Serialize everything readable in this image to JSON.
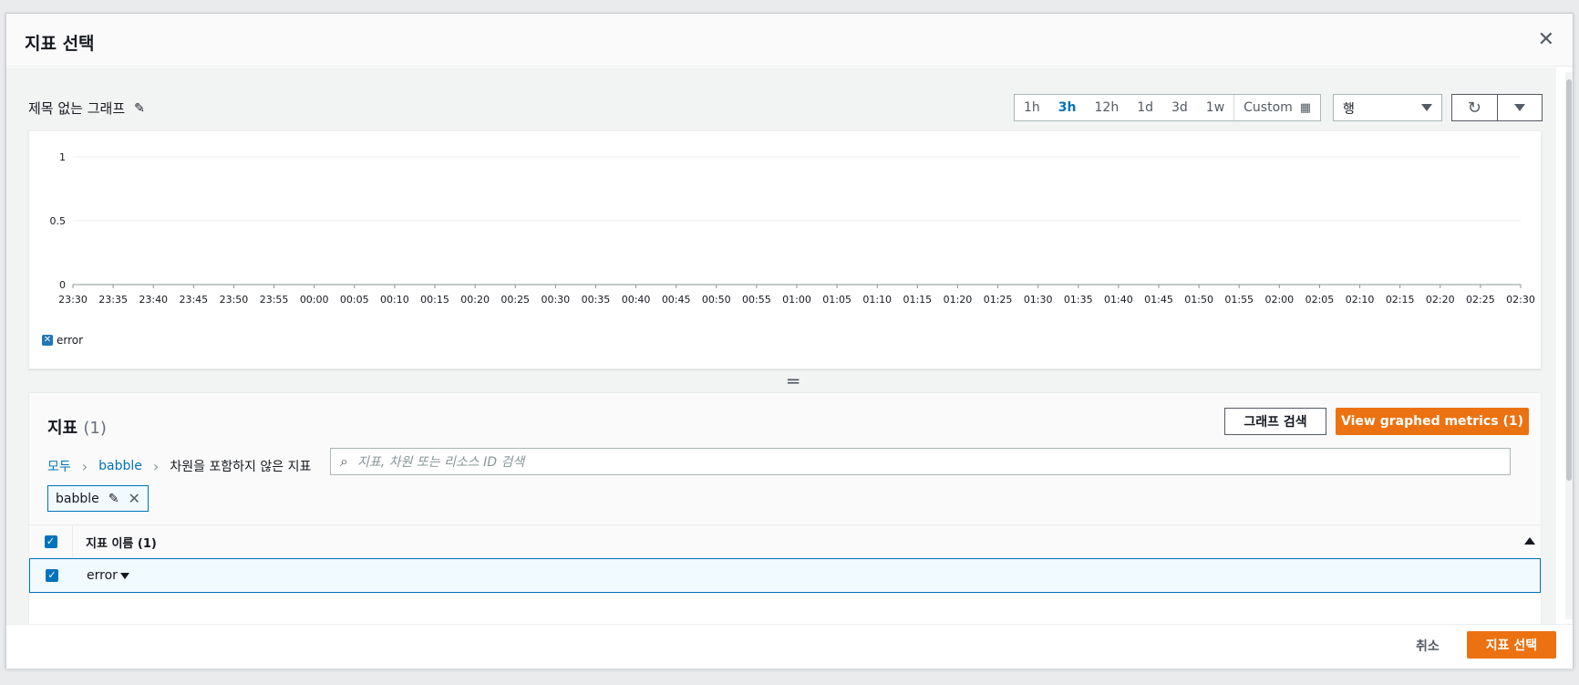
{
  "modal": {
    "title": "지표 선택",
    "close_icon": "close-icon"
  },
  "graph": {
    "title": "제목 없는 그래프",
    "edit_icon": "edit-icon"
  },
  "time_ranges": [
    "1h",
    "3h",
    "12h",
    "1d",
    "3d",
    "1w"
  ],
  "time_active": "3h",
  "custom_label": "Custom",
  "view_select": "행",
  "chart_data": {
    "type": "line",
    "y_ticks": [
      "1",
      "0.5",
      "0"
    ],
    "ylim": [
      0,
      1
    ],
    "x_ticks": [
      "23:30",
      "23:35",
      "23:40",
      "23:45",
      "23:50",
      "23:55",
      "00:00",
      "00:05",
      "00:10",
      "00:15",
      "00:20",
      "00:25",
      "00:30",
      "00:35",
      "00:40",
      "00:45",
      "00:50",
      "00:55",
      "01:00",
      "01:05",
      "01:10",
      "01:15",
      "01:20",
      "01:25",
      "01:30",
      "01:35",
      "01:40",
      "01:45",
      "01:50",
      "01:55",
      "02:00",
      "02:05",
      "02:10",
      "02:15",
      "02:20",
      "02:25",
      "02:30"
    ],
    "series": [
      {
        "name": "error",
        "values": []
      }
    ],
    "grid": true,
    "legend": "bottom-left",
    "colors": {
      "series": "#1f77b4"
    }
  },
  "panel": {
    "title": "지표",
    "count": "(1)",
    "graph_search_label": "그래프 검색",
    "view_graphed_label": "View graphed metrics (1)",
    "crumbs": {
      "all": "모두",
      "ns": "babble",
      "current": "차원을 포함하지 않은 지표"
    },
    "search_placeholder": "지표, 차원 또는 리소스 ID 검색",
    "token": "babble",
    "col_header": "지표 이름  (1)",
    "row_value": "error"
  },
  "footer": {
    "cancel_label": "취소",
    "select_label": "지표 선택"
  },
  "colors": {
    "accent": "#ec7211",
    "link": "#0073bb"
  }
}
